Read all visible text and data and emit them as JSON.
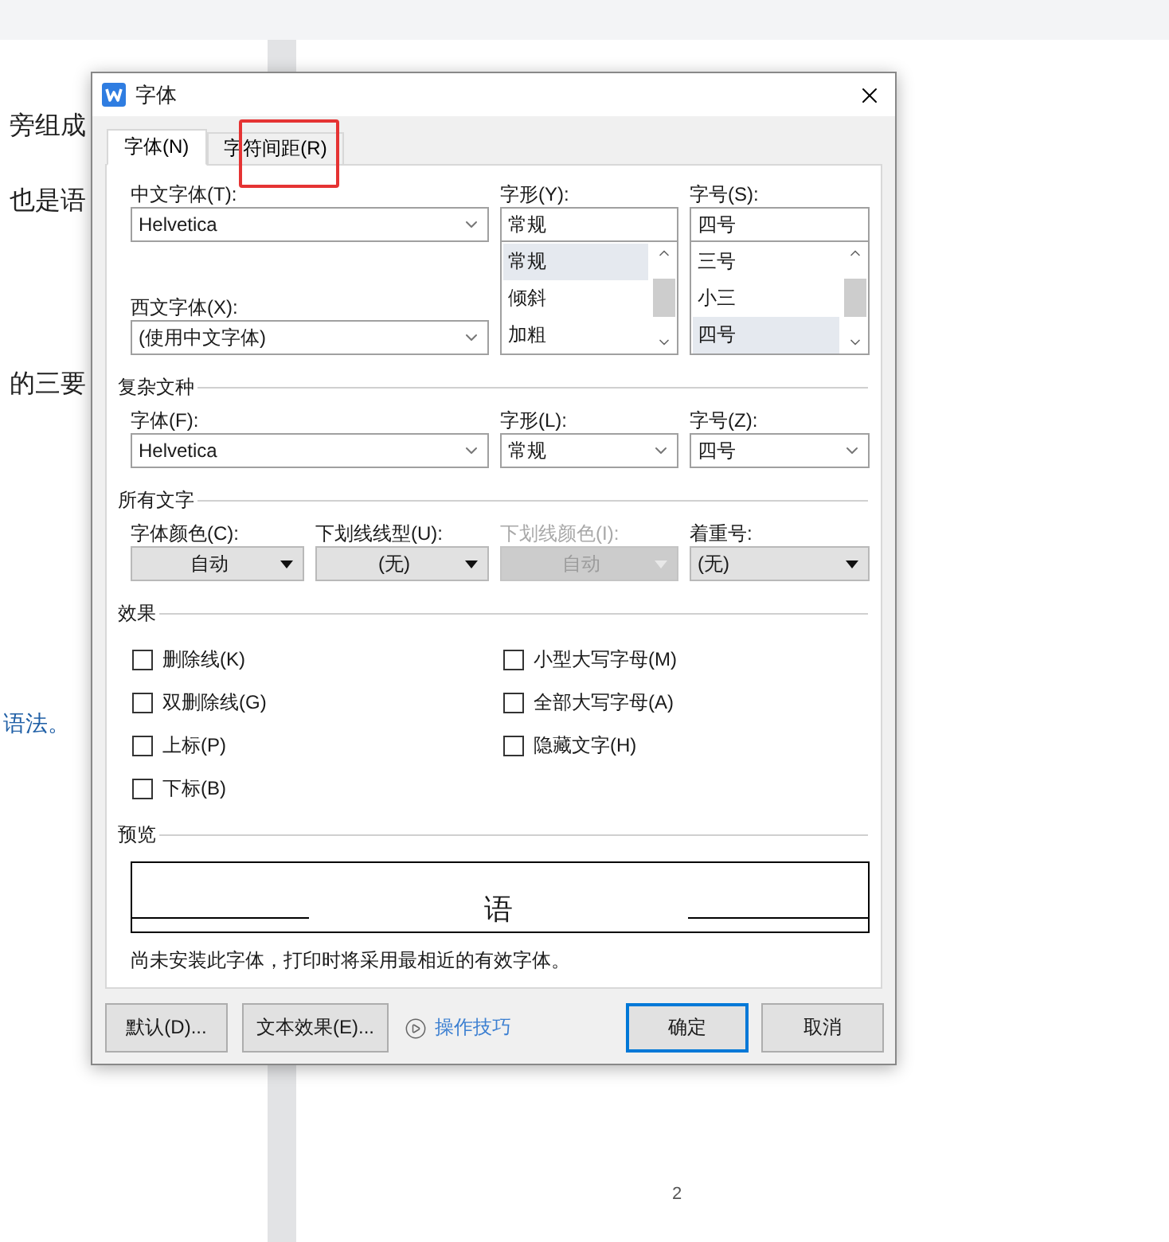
{
  "document": {
    "fragments": [
      {
        "text": "旁组成",
        "kind": "plain"
      },
      {
        "text": "也是语",
        "kind": "plain"
      },
      {
        "text": "的三要",
        "kind": "plain"
      },
      {
        "text": "语法。",
        "kind": "link"
      }
    ],
    "page_number": "2"
  },
  "dialog": {
    "title": "字体",
    "tabs": [
      {
        "label": "字体(N)",
        "selected": true,
        "highlighted": false
      },
      {
        "label": "字符间距(R)",
        "selected": false,
        "highlighted": true
      }
    ],
    "chinese_font": {
      "label": "中文字体(T):",
      "value": "Helvetica"
    },
    "western_font": {
      "label": "西文字体(X):",
      "value": "(使用中文字体)"
    },
    "style": {
      "label": "字形(Y):",
      "value": "常规",
      "options": [
        {
          "text": "常规",
          "selected": true
        },
        {
          "text": "倾斜",
          "selected": false
        },
        {
          "text": "加粗",
          "selected": false
        }
      ]
    },
    "size": {
      "label": "字号(S):",
      "value": "四号",
      "options": [
        {
          "text": "三号",
          "selected": false
        },
        {
          "text": "小三",
          "selected": false
        },
        {
          "text": "四号",
          "selected": true
        }
      ]
    },
    "complex_script": {
      "title": "复杂文种",
      "fields": [
        {
          "label": "字体(F):",
          "value": "Helvetica"
        },
        {
          "label": "字形(L):",
          "value": "常规"
        },
        {
          "label": "字号(Z):",
          "value": "四号"
        }
      ]
    },
    "all_text": {
      "title": "所有文字",
      "fields": [
        {
          "label": "字体颜色(C):",
          "value": "自动",
          "disabled": false
        },
        {
          "label": "下划线线型(U):",
          "value": "(无)",
          "disabled": false
        },
        {
          "label": "下划线颜色(I):",
          "value": "自动",
          "disabled": true
        },
        {
          "label": "着重号:",
          "value": "(无)",
          "disabled": false
        }
      ]
    },
    "effects": {
      "title": "效果",
      "items": [
        {
          "label": "删除线(K)",
          "checked": false
        },
        {
          "label": "小型大写字母(M)",
          "checked": false
        },
        {
          "label": "双删除线(G)",
          "checked": false
        },
        {
          "label": "全部大写字母(A)",
          "checked": false
        },
        {
          "label": "上标(P)",
          "checked": false
        },
        {
          "label": "隐藏文字(H)",
          "checked": false
        },
        {
          "label": "下标(B)",
          "checked": false
        }
      ]
    },
    "preview": {
      "title": "预览",
      "sample": "语",
      "note": "尚未安装此字体，打印时将采用最相近的有效字体。"
    },
    "left_buttons": [
      {
        "label": "默认(D)...",
        "kind": "button"
      },
      {
        "label": "文本效果(E)...",
        "kind": "button"
      },
      {
        "label": "操作技巧",
        "kind": "link"
      }
    ],
    "right_buttons": [
      {
        "label": "确定",
        "kind": "button",
        "default": true
      },
      {
        "label": "取消",
        "kind": "button",
        "default": false
      }
    ]
  }
}
